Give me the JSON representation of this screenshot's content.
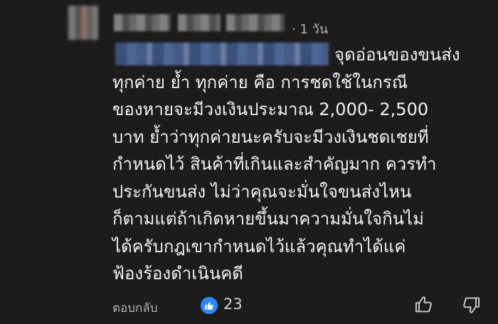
{
  "comment": {
    "timestamp": "· 1 วัน",
    "lines": [
      "จุดอ่อนของขนส่ง",
      "ทุกค่าย ย้ำ ทุกค่าย คือ การชดใช้ในกรณี",
      "ของหายจะมีวงเงินประมาณ 2,000- 2,500",
      "บาท ย้ำว่าทุกค่ายนะครับจะมีวงเงินชดเชยที่",
      "กำหนดไว้ สินค้าที่เกินและสำคัญมาก ควรทำ",
      "ประกันขนส่ง ไม่ว่าคุณจะมั่นใจขนส่งไหน",
      "ก็ตามแต่ถ้าเกิดหายขึ้นมาความมั่นใจกินไม่",
      "ได้ครับกฎเขากำหนดไว้แล้วคุณทำได้แค่",
      "ฟ้องร้องดำเนินคดี"
    ]
  },
  "actions": {
    "reply_label": "ตอบกลับ",
    "like_count": "23",
    "like_icon": "thumbs-up-icon",
    "dislike_icon": "thumbs-down-icon"
  },
  "colors": {
    "background": "#1c1c1d",
    "text": "#f2f2f2",
    "secondary_text": "#b0b3b8",
    "like_badge": "#2d88ff"
  }
}
